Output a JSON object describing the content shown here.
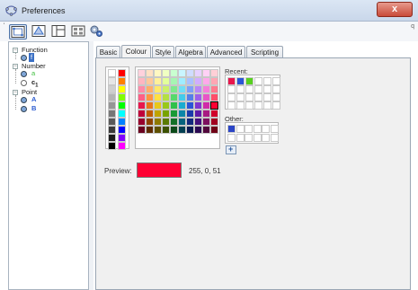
{
  "window": {
    "title": "Preferences",
    "close_glyph": "x"
  },
  "toolbar": {
    "back_mark": "ˈ",
    "right_mark": "q",
    "buttons": [
      {
        "name": "graphics-prefs",
        "icon": "graphics-icon",
        "active": true
      },
      {
        "name": "graphics2-prefs",
        "icon": "triangle-icon",
        "active": false
      },
      {
        "name": "layout-prefs",
        "icon": "layout-icon",
        "active": false
      },
      {
        "name": "cas-prefs",
        "icon": "cas-icon",
        "active": false
      },
      {
        "name": "advanced-prefs",
        "icon": "cogs-icon",
        "active": false
      }
    ]
  },
  "tree": {
    "groups": [
      {
        "label": "Function",
        "expander": "−",
        "items": [
          {
            "label": "f",
            "color": "#d8000a",
            "kind": "dot",
            "selected": true
          }
        ]
      },
      {
        "label": "Number",
        "expander": "−",
        "items": [
          {
            "label": "a",
            "color": "#3fbf3f",
            "kind": "dot",
            "selected": false
          },
          {
            "label": "c",
            "sub": "1",
            "color": "#ffffff",
            "kind": "ring",
            "selected": false
          }
        ]
      },
      {
        "label": "Point",
        "expander": "−",
        "items": [
          {
            "label": "A",
            "color": "#2b5bd0",
            "kind": "dot",
            "selected": false
          },
          {
            "label": "B",
            "color": "#2b5bd0",
            "kind": "dot",
            "selected": false
          }
        ]
      }
    ]
  },
  "tabs": [
    {
      "label": "Basic",
      "active": false
    },
    {
      "label": "Colour",
      "active": true
    },
    {
      "label": "Style",
      "active": false
    },
    {
      "label": "Algebra",
      "active": false
    },
    {
      "label": "Advanced",
      "active": false
    },
    {
      "label": "Scripting",
      "active": false
    }
  ],
  "colour": {
    "recent_label": "Recent:",
    "other_label": "Other:",
    "preview_label": "Preview:",
    "preview_color": "#ff0033",
    "rgb_text": "255, 0, 51",
    "recent_colors": [
      "#e8174d",
      "#2b55d6",
      "#57d020"
    ],
    "other_colors": [
      "#2b45c7"
    ],
    "gray_column": [
      "#ffffff",
      "#e6e6e6",
      "#cfcfcf",
      "#b4b4b4",
      "#969696",
      "#777777",
      "#595959",
      "#3a3a3a",
      "#1c1c1c",
      "#000000"
    ],
    "bright_column": [
      "#ff0000",
      "#ff7f00",
      "#ffff00",
      "#80ff00",
      "#00ff00",
      "#00ffff",
      "#0080ff",
      "#0000ff",
      "#8000ff",
      "#ff00ff"
    ],
    "main_grid": [
      [
        "#ffd1dc",
        "#ffb6c1",
        "#ff8aa8",
        "#ff5f86",
        "#e8174d",
        "#c0003a",
        "#98002d",
        "#6b001f"
      ],
      [
        "#ffe0c2",
        "#ffc89a",
        "#ffae6a",
        "#ff9440",
        "#e8741a",
        "#c05a00",
        "#8f4300",
        "#5f2c00"
      ],
      [
        "#fff8c2",
        "#fff09a",
        "#ffe86a",
        "#ffe040",
        "#e8c81a",
        "#c0a300",
        "#8f7a00",
        "#5f5100"
      ],
      [
        "#f0ffc2",
        "#e2ff9a",
        "#ccf06a",
        "#b4e040",
        "#98c81a",
        "#78a300",
        "#5a7a00",
        "#3c5100"
      ],
      [
        "#c9ffd0",
        "#a6f5b2",
        "#7fe88e",
        "#56d96b",
        "#2fc04a",
        "#1a9a36",
        "#127027",
        "#0b4a19"
      ],
      [
        "#c9f5ff",
        "#a0ecff",
        "#70def5",
        "#42cbea",
        "#1aacd0",
        "#0a86a8",
        "#06637d",
        "#034052"
      ],
      [
        "#cfdcff",
        "#a9c0ff",
        "#7f9ff5",
        "#557ee8",
        "#2b55d6",
        "#1a3aaa",
        "#12297d",
        "#0a1a52"
      ],
      [
        "#e6d1ff",
        "#d1adff",
        "#b886f5",
        "#9d5fea",
        "#7f35d0",
        "#5f1aa8",
        "#43107d",
        "#2b0852"
      ],
      [
        "#ffd1f5",
        "#ffa9ea",
        "#f57fd9",
        "#e855c6",
        "#d02aa8",
        "#a81a82",
        "#7d105f",
        "#52083d"
      ],
      [
        "#ffcfd6",
        "#ffa6b3",
        "#ff7a8e",
        "#ff4d69",
        "#ff0033",
        "#d00029",
        "#a0001f",
        "#700016"
      ]
    ]
  }
}
